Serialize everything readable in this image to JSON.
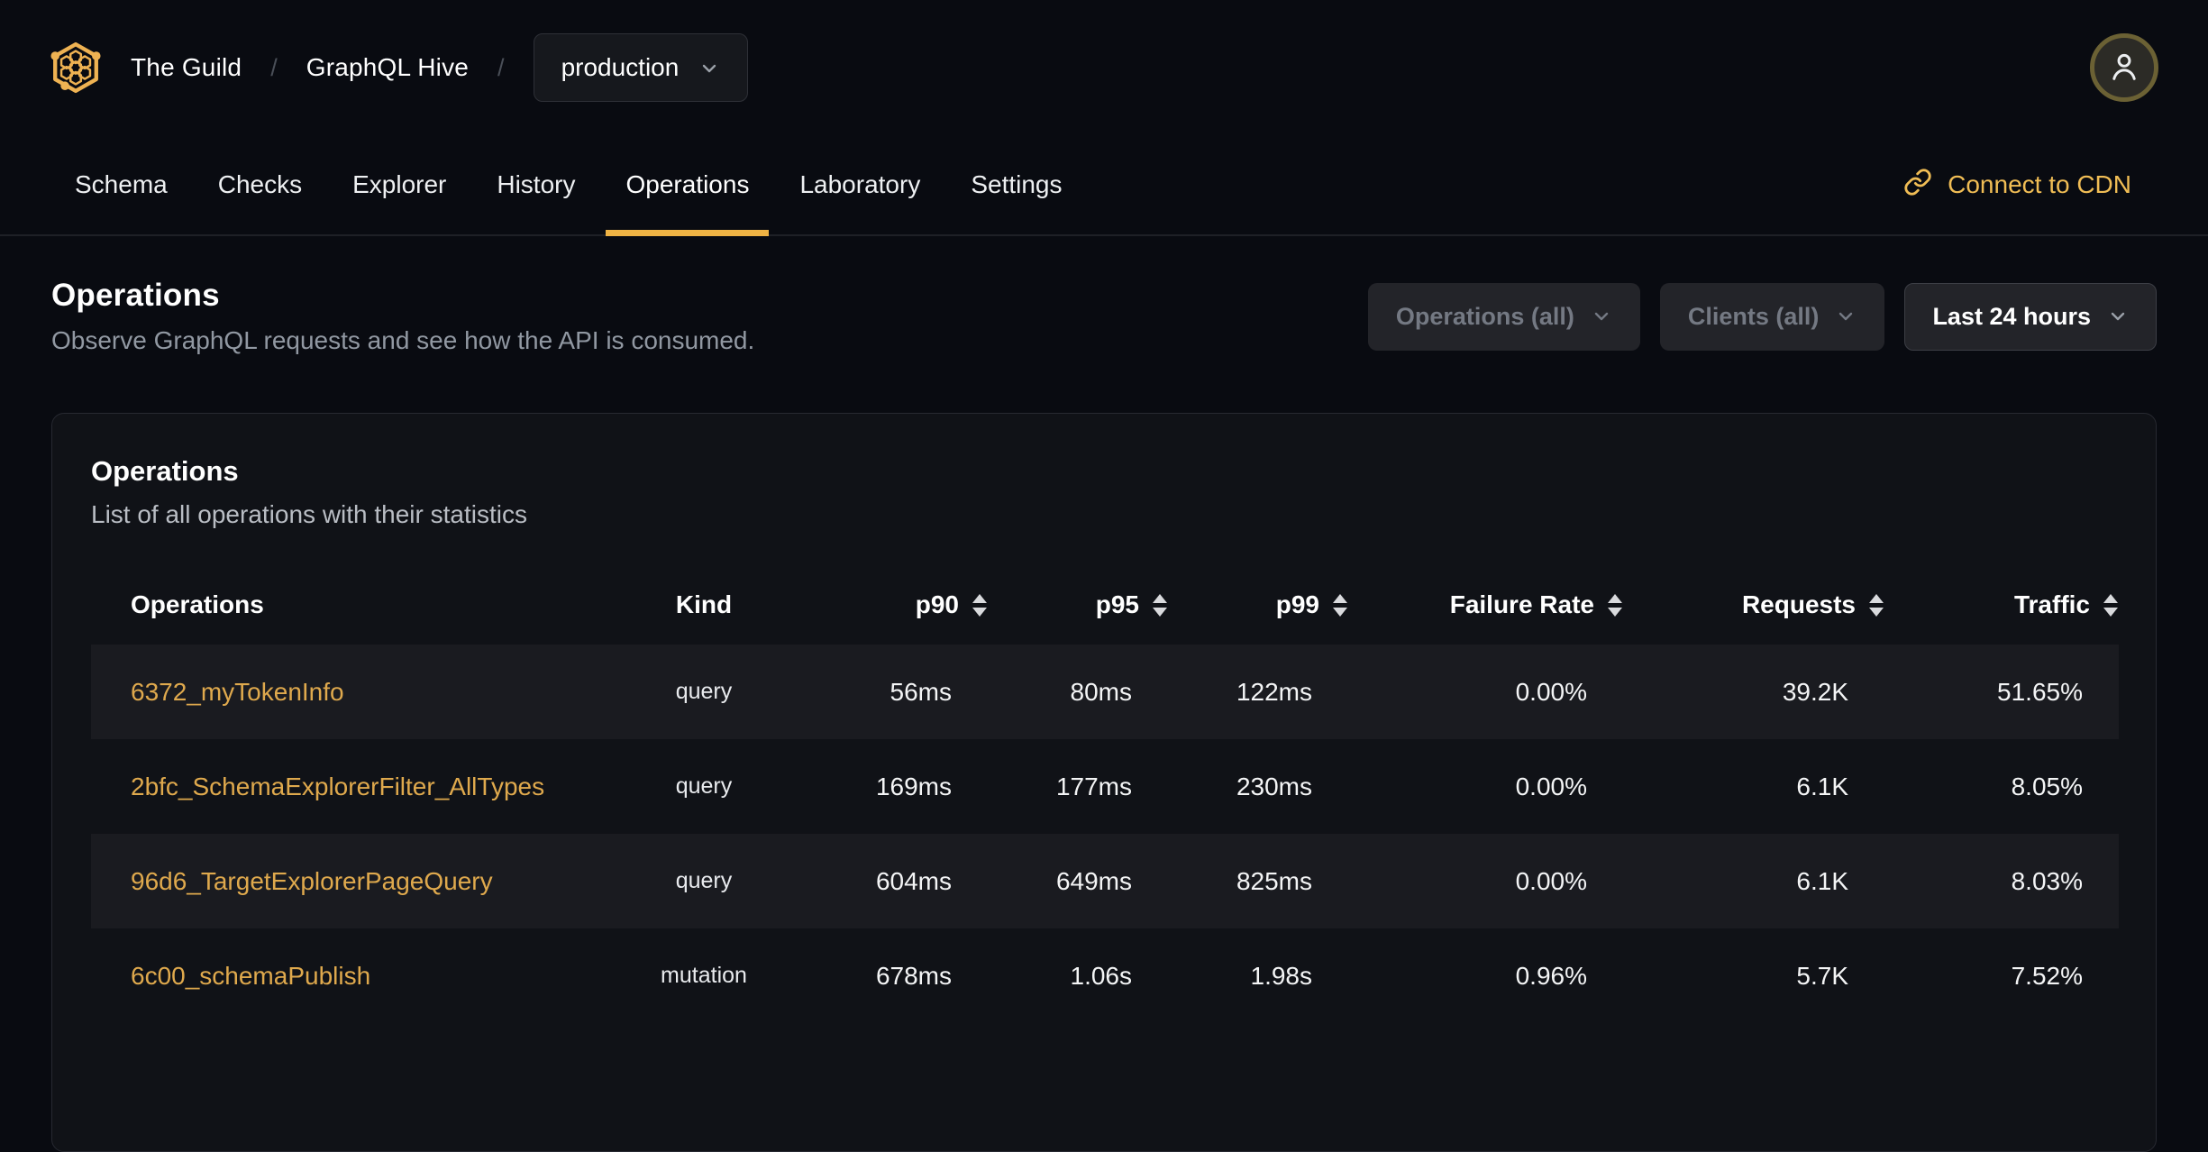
{
  "colors": {
    "accent_gold": "#efb344",
    "link_gold": "#dfa94d",
    "page_bg": "#090b11",
    "card_bg": "#101217",
    "row_stripe_bg": "#1a1b20",
    "button_bg": "#232429",
    "muted_text": "#9198a2"
  },
  "header": {
    "org": "The Guild",
    "separator": "/",
    "project": "GraphQL Hive",
    "target_selector": {
      "value": "production",
      "icon": "chevron-down-icon"
    },
    "logo_icon": "hive-logo-icon",
    "avatar_icon": "user-icon"
  },
  "nav": {
    "tabs": [
      {
        "label": "Schema",
        "active": false
      },
      {
        "label": "Checks",
        "active": false
      },
      {
        "label": "Explorer",
        "active": false
      },
      {
        "label": "History",
        "active": false
      },
      {
        "label": "Operations",
        "active": true
      },
      {
        "label": "Laboratory",
        "active": false
      },
      {
        "label": "Settings",
        "active": false
      }
    ],
    "cdn_link": {
      "label": "Connect to CDN",
      "icon": "link-icon"
    }
  },
  "page": {
    "title": "Operations",
    "subtitle": "Observe GraphQL requests and see how the API is consumed."
  },
  "filters": {
    "operations_label": "Operations (all)",
    "clients_label": "Clients (all)",
    "period_label": "Last 24 hours"
  },
  "card": {
    "title": "Operations",
    "subtitle": "List of all operations with their statistics"
  },
  "table": {
    "columns": [
      {
        "label": "Operations",
        "sortable": false
      },
      {
        "label": "Kind",
        "sortable": false
      },
      {
        "label": "p90",
        "sortable": true
      },
      {
        "label": "p95",
        "sortable": true
      },
      {
        "label": "p99",
        "sortable": true
      },
      {
        "label": "Failure Rate",
        "sortable": true
      },
      {
        "label": "Requests",
        "sortable": true
      },
      {
        "label": "Traffic",
        "sortable": true
      }
    ],
    "rows": [
      {
        "name": "6372_myTokenInfo",
        "kind": "query",
        "p90": "56ms",
        "p95": "80ms",
        "p99": "122ms",
        "failure_rate": "0.00%",
        "requests": "39.2K",
        "traffic": "51.65%"
      },
      {
        "name": "2bfc_SchemaExplorerFilter_AllTypes",
        "kind": "query",
        "p90": "169ms",
        "p95": "177ms",
        "p99": "230ms",
        "failure_rate": "0.00%",
        "requests": "6.1K",
        "traffic": "8.05%"
      },
      {
        "name": "96d6_TargetExplorerPageQuery",
        "kind": "query",
        "p90": "604ms",
        "p95": "649ms",
        "p99": "825ms",
        "failure_rate": "0.00%",
        "requests": "6.1K",
        "traffic": "8.03%"
      },
      {
        "name": "6c00_schemaPublish",
        "kind": "mutation",
        "p90": "678ms",
        "p95": "1.06s",
        "p99": "1.98s",
        "failure_rate": "0.96%",
        "requests": "5.7K",
        "traffic": "7.52%"
      }
    ]
  }
}
